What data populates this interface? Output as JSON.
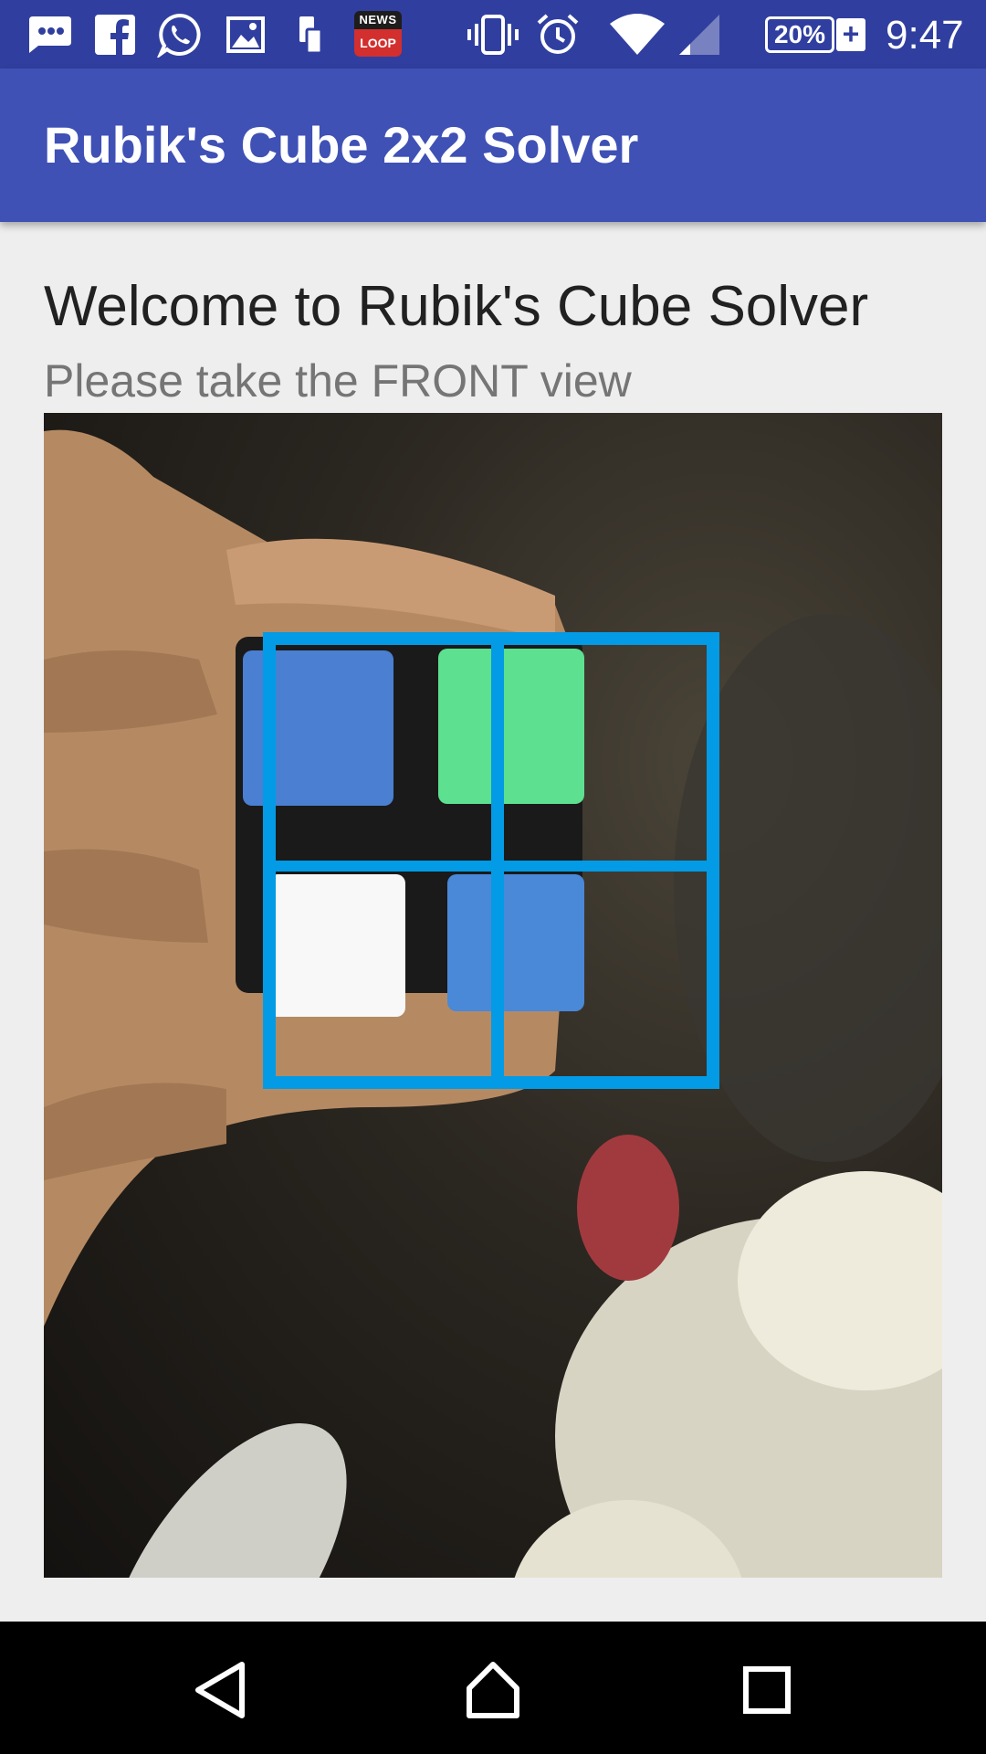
{
  "status_bar": {
    "icons": [
      "messages-icon",
      "facebook-icon",
      "whatsapp-icon",
      "gallery-icon",
      "device-icon",
      "news-loop-icon",
      "vibrate-icon",
      "alarm-icon",
      "wifi-icon",
      "signal-icon"
    ],
    "news_badge_top": "NEWS",
    "news_badge_bottom": "LOOP",
    "battery": "20%",
    "battery_charging": "+",
    "time": "9:47"
  },
  "app_bar": {
    "title": "Rubik's Cube 2x2 Solver",
    "color": "#3f51b5"
  },
  "main": {
    "welcome": "Welcome to Rubik's Cube Solver",
    "instruction": "Please take the FRONT view",
    "grid_color": "#039be5",
    "cube_faces": [
      {
        "color_name": "blue",
        "hex": "#4a7fd1"
      },
      {
        "color_name": "green",
        "hex": "#5de08f"
      },
      {
        "color_name": "white",
        "hex": "#f8f8f8"
      },
      {
        "color_name": "blue",
        "hex": "#4a88d8"
      }
    ]
  },
  "nav_bar": {
    "items": [
      "back-icon",
      "home-icon",
      "recents-icon"
    ]
  }
}
